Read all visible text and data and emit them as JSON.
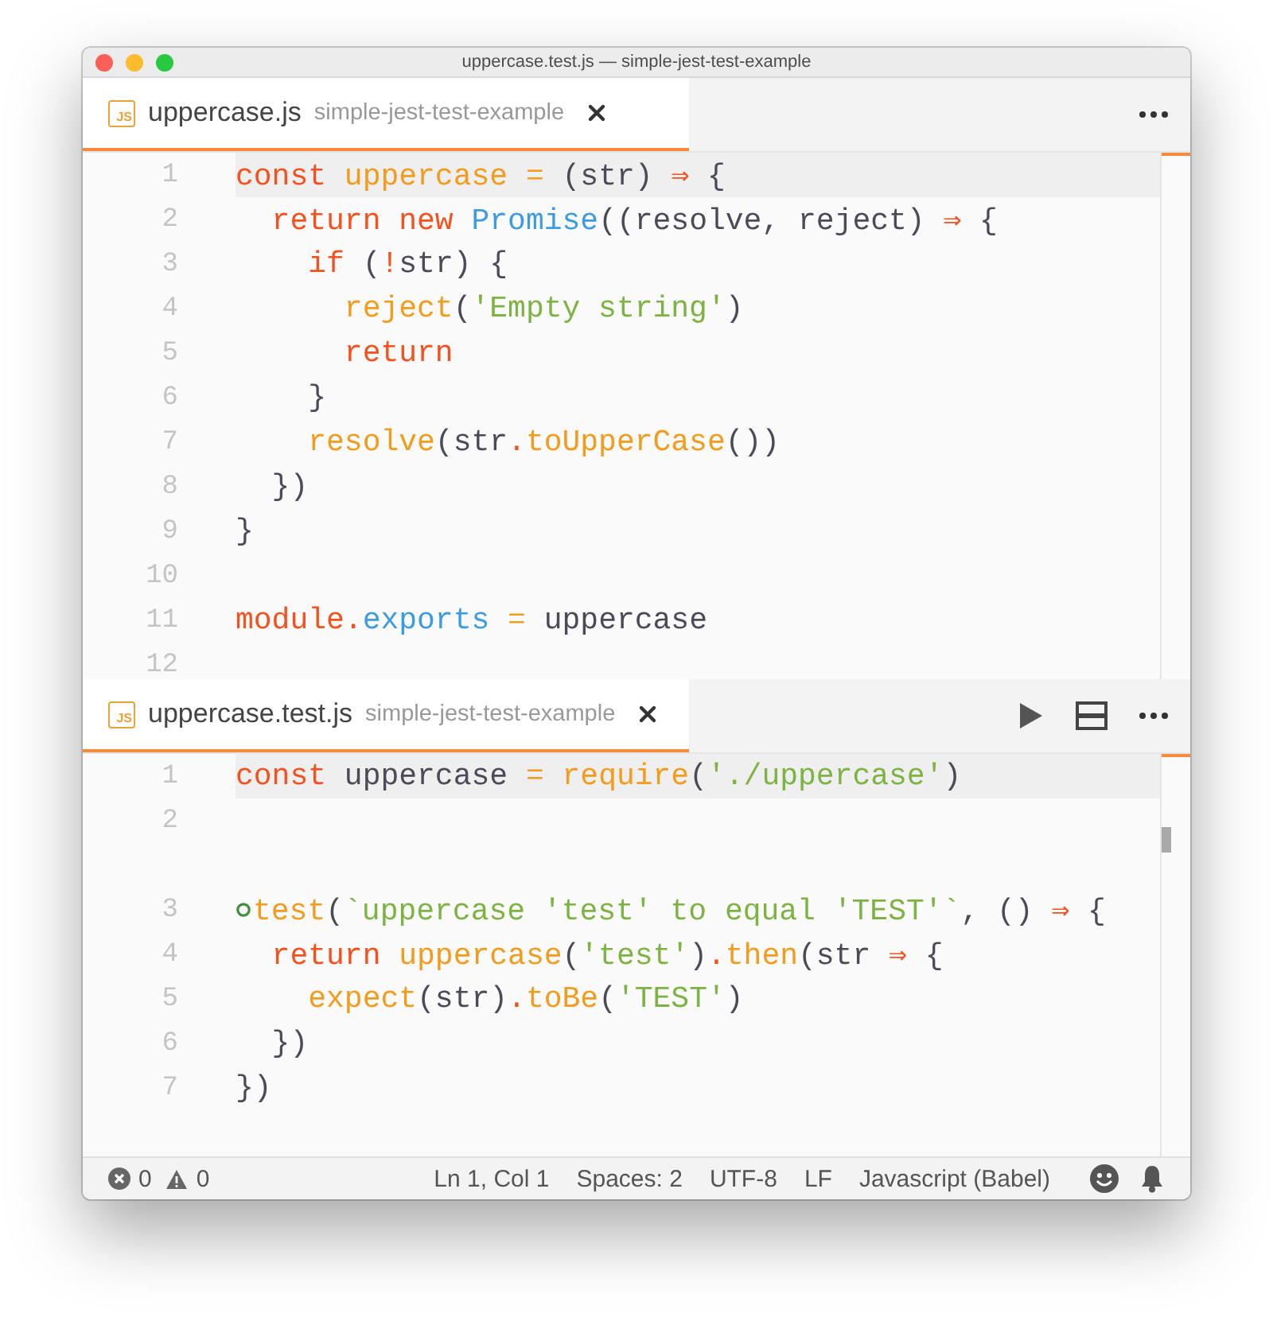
{
  "window": {
    "title": "uppercase.test.js — simple-jest-test-example"
  },
  "panes": [
    {
      "tab": {
        "icon_label": "JS",
        "file": "uppercase.js",
        "folder": "simple-jest-test-example",
        "selected": true
      },
      "actions": [
        {
          "kind": "more"
        }
      ],
      "scrollbar": {
        "kind": "cursor"
      },
      "lines": [
        {
          "number": "1",
          "current": true,
          "tokens": [
            {
              "t": "const ",
              "kind": "kw"
            },
            {
              "t": "uppercase ",
              "kind": "fn"
            },
            {
              "t": "= ",
              "kind": "fn"
            },
            {
              "t": "(str) ",
              "kind": "plain"
            },
            {
              "t": "⇒ ",
              "kind": "kw"
            },
            {
              "t": "{",
              "kind": "plain"
            }
          ]
        },
        {
          "number": "2",
          "tokens": [
            {
              "t": "  return new ",
              "kind": "kw"
            },
            {
              "t": "Promise",
              "kind": "type"
            },
            {
              "t": "((resolve, reject) ",
              "kind": "plain"
            },
            {
              "t": "⇒ ",
              "kind": "kw"
            },
            {
              "t": "{",
              "kind": "plain"
            }
          ]
        },
        {
          "number": "3",
          "tokens": [
            {
              "t": "    if ",
              "kind": "kw"
            },
            {
              "t": "(",
              "kind": "plain"
            },
            {
              "t": "!",
              "kind": "kw"
            },
            {
              "t": "str) {",
              "kind": "plain"
            }
          ]
        },
        {
          "number": "4",
          "tokens": [
            {
              "t": "      reject",
              "kind": "fn"
            },
            {
              "t": "(",
              "kind": "plain"
            },
            {
              "t": "'Empty string'",
              "kind": "str"
            },
            {
              "t": ")",
              "kind": "plain"
            }
          ]
        },
        {
          "number": "5",
          "tokens": [
            {
              "t": "      return",
              "kind": "kw"
            }
          ]
        },
        {
          "number": "6",
          "tokens": [
            {
              "t": "    }",
              "kind": "plain"
            }
          ]
        },
        {
          "number": "7",
          "tokens": [
            {
              "t": "    resolve",
              "kind": "fn"
            },
            {
              "t": "(str",
              "kind": "plain"
            },
            {
              "t": ".",
              "kind": "kw"
            },
            {
              "t": "toUpperCase",
              "kind": "fn"
            },
            {
              "t": "())",
              "kind": "plain"
            }
          ]
        },
        {
          "number": "8",
          "tokens": [
            {
              "t": "  })",
              "kind": "plain"
            }
          ]
        },
        {
          "number": "9",
          "tokens": [
            {
              "t": "}",
              "kind": "plain"
            }
          ]
        },
        {
          "number": "10"
        },
        {
          "number": "11",
          "tokens": [
            {
              "t": "module",
              "kind": "kw"
            },
            {
              "t": ".",
              "kind": "kw"
            },
            {
              "t": "exports ",
              "kind": "type"
            },
            {
              "t": "= ",
              "kind": "fn"
            },
            {
              "t": "uppercase",
              "kind": "plain"
            }
          ]
        },
        {
          "number": "12"
        }
      ]
    },
    {
      "tab": {
        "icon_label": "JS",
        "file": "uppercase.test.js",
        "folder": "simple-jest-test-example",
        "selected": true
      },
      "actions": [
        {
          "kind": "run"
        },
        {
          "kind": "split"
        },
        {
          "kind": "more"
        }
      ],
      "scrollbar": {
        "kind": "thumb"
      },
      "lines": [
        {
          "number": "1",
          "current": true,
          "tokens": [
            {
              "t": "const ",
              "kind": "kw"
            },
            {
              "t": "uppercase ",
              "kind": "plain"
            },
            {
              "t": "= ",
              "kind": "fn"
            },
            {
              "t": "require",
              "kind": "fn"
            },
            {
              "t": "(",
              "kind": "plain"
            },
            {
              "t": "'./uppercase'",
              "kind": "str"
            },
            {
              "t": ")",
              "kind": "plain"
            }
          ]
        },
        {
          "number": "2"
        },
        {
          "number": "3",
          "gap_before": true,
          "test_marker": true,
          "tokens": [
            {
              "t": "test",
              "kind": "fn"
            },
            {
              "t": "(",
              "kind": "plain"
            },
            {
              "t": "`uppercase 'test' to equal 'TEST'`",
              "kind": "str"
            },
            {
              "t": ", () ",
              "kind": "plain"
            },
            {
              "t": "⇒ ",
              "kind": "kw"
            },
            {
              "t": "{",
              "kind": "plain"
            }
          ]
        },
        {
          "number": "4",
          "tokens": [
            {
              "t": "  return ",
              "kind": "kw"
            },
            {
              "t": "uppercase",
              "kind": "fn"
            },
            {
              "t": "(",
              "kind": "plain"
            },
            {
              "t": "'test'",
              "kind": "str"
            },
            {
              "t": ")",
              "kind": "plain"
            },
            {
              "t": ".",
              "kind": "kw"
            },
            {
              "t": "then",
              "kind": "fn"
            },
            {
              "t": "(str ",
              "kind": "plain"
            },
            {
              "t": "⇒ ",
              "kind": "kw"
            },
            {
              "t": "{",
              "kind": "plain"
            }
          ]
        },
        {
          "number": "5",
          "tokens": [
            {
              "t": "    expect",
              "kind": "fn"
            },
            {
              "t": "(str)",
              "kind": "plain"
            },
            {
              "t": ".",
              "kind": "kw"
            },
            {
              "t": "toBe",
              "kind": "fn"
            },
            {
              "t": "(",
              "kind": "plain"
            },
            {
              "t": "'TEST'",
              "kind": "str"
            },
            {
              "t": ")",
              "kind": "plain"
            }
          ]
        },
        {
          "number": "6",
          "tokens": [
            {
              "t": "  })",
              "kind": "plain"
            }
          ]
        },
        {
          "number": "7",
          "tokens": [
            {
              "t": "})",
              "kind": "plain"
            }
          ]
        }
      ]
    }
  ],
  "status_bar": {
    "errors": "0",
    "warnings": "0",
    "items": [
      "Ln 1, Col 1",
      "Spaces: 2",
      "UTF-8",
      "LF",
      "Javascript (Babel)"
    ]
  }
}
